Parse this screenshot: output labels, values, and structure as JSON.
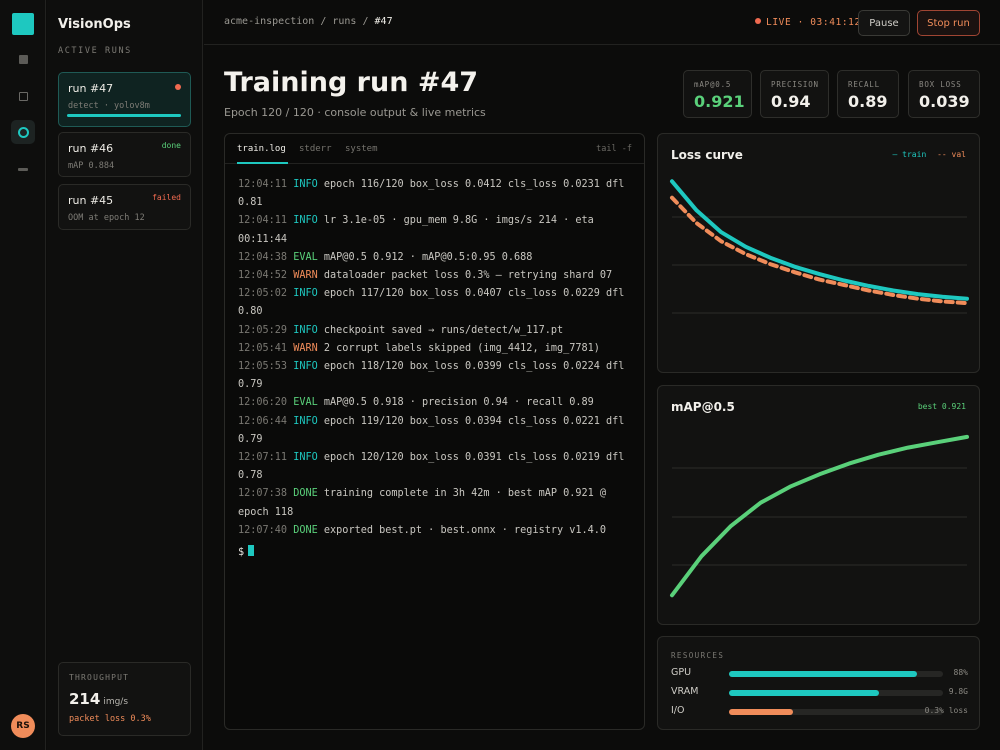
{
  "app": {
    "name": "VisionOps"
  },
  "colors": {
    "accent": "#1ec8c0",
    "good": "#5ad07a",
    "warn": "#f08c5a",
    "danger": "#f06a50"
  },
  "rail": {
    "icons": [
      "logo-icon",
      "dashboard-icon",
      "datasets-icon",
      "runs-icon",
      "settings-icon"
    ],
    "avatar": "RS"
  },
  "sidebar": {
    "section_label": "ACTIVE RUNS",
    "runs": [
      {
        "name": "run #47",
        "sub": "detect · yolov8m",
        "status": "",
        "progress": 1.0
      },
      {
        "name": "run #46",
        "sub": "mAP 0.884",
        "status": "done"
      },
      {
        "name": "run #45",
        "sub": "OOM at epoch 12",
        "status": "failed"
      }
    ],
    "throughput": {
      "label": "THROUGHPUT",
      "value": "214",
      "unit": "img/s",
      "warning": "packet loss 0.3%"
    }
  },
  "topbar": {
    "breadcrumb": [
      "acme-inspection",
      "runs",
      "#47"
    ],
    "live_label": "LIVE · 03:41:12",
    "pause_label": "Pause",
    "stop_label": "Stop run"
  },
  "header": {
    "title": "Training run #47",
    "subtitle": "Epoch 120 / 120 · console output & live metrics"
  },
  "kpis": [
    {
      "label": "mAP@0.5",
      "value": "0.921"
    },
    {
      "label": "PRECISION",
      "value": "0.94"
    },
    {
      "label": "RECALL",
      "value": "0.89"
    },
    {
      "label": "BOX LOSS",
      "value": "0.039"
    }
  ],
  "console": {
    "tabs": [
      "train.log",
      "stderr",
      "system"
    ],
    "tail_label": "tail -f",
    "lines": [
      {
        "ts": "12:04:11",
        "level": "INFO",
        "msg": "epoch 116/120 box_loss 0.0412 cls_loss 0.0231 dfl 0.81"
      },
      {
        "ts": "12:04:11",
        "level": "INFO",
        "msg": "lr 3.1e-05 · gpu_mem 9.8G · imgs/s 214 · eta 00:11:44"
      },
      {
        "ts": "12:04:38",
        "level": "EVAL",
        "msg": "mAP@0.5 0.912 · mAP@0.5:0.95 0.688"
      },
      {
        "ts": "12:04:52",
        "level": "WARN",
        "msg": "dataloader packet loss 0.3% — retrying shard 07"
      },
      {
        "ts": "12:05:02",
        "level": "INFO",
        "msg": "epoch 117/120 box_loss 0.0407 cls_loss 0.0229 dfl 0.80"
      },
      {
        "ts": "12:05:29",
        "level": "INFO",
        "msg": "checkpoint saved → runs/detect/w_117.pt"
      },
      {
        "ts": "12:05:41",
        "level": "WARN",
        "msg": "2 corrupt labels skipped (img_4412, img_7781)"
      },
      {
        "ts": "12:05:53",
        "level": "INFO",
        "msg": "epoch 118/120 box_loss 0.0399 cls_loss 0.0224 dfl 0.79"
      },
      {
        "ts": "12:06:20",
        "level": "EVAL",
        "msg": "mAP@0.5 0.918 · precision 0.94 · recall 0.89"
      },
      {
        "ts": "12:06:44",
        "level": "INFO",
        "msg": "epoch 119/120 box_loss 0.0394 cls_loss 0.0221 dfl 0.79"
      },
      {
        "ts": "12:07:11",
        "level": "INFO",
        "msg": "epoch 120/120 box_loss 0.0391 cls_loss 0.0219 dfl 0.78"
      },
      {
        "ts": "12:07:38",
        "level": "DONE",
        "msg": "training complete in 3h 42m · best mAP 0.921 @ epoch 118"
      },
      {
        "ts": "12:07:40",
        "level": "DONE",
        "msg": "exported best.pt · best.onnx · registry v1.4.0"
      }
    ],
    "prompt": "$"
  },
  "chart_data": [
    {
      "type": "line",
      "title": "Loss curve",
      "legend": "top-right",
      "grid": true,
      "ylim": [
        0,
        1
      ],
      "x": [
        0,
        1,
        2,
        3,
        4,
        5,
        6,
        7,
        8,
        9,
        10,
        11,
        12
      ],
      "series": [
        {
          "name": "train",
          "color": "#1ec8c0",
          "dashed": false,
          "values": [
            0.96,
            0.8,
            0.68,
            0.6,
            0.54,
            0.49,
            0.45,
            0.415,
            0.385,
            0.36,
            0.34,
            0.325,
            0.315
          ]
        },
        {
          "name": "val",
          "color": "#f08c5a",
          "dashed": true,
          "values": [
            0.87,
            0.73,
            0.63,
            0.56,
            0.505,
            0.46,
            0.42,
            0.39,
            0.36,
            0.335,
            0.315,
            0.3,
            0.29
          ]
        }
      ]
    },
    {
      "type": "line",
      "title": "mAP@0.5",
      "annotation": "best 0.921",
      "grid": true,
      "ylim": [
        0,
        1
      ],
      "x": [
        0,
        1,
        2,
        3,
        4,
        5,
        6,
        7,
        8,
        9,
        10
      ],
      "series": [
        {
          "name": "",
          "color": "#5ad07a",
          "dashed": false,
          "values": [
            0.06,
            0.28,
            0.45,
            0.58,
            0.67,
            0.74,
            0.8,
            0.85,
            0.89,
            0.92,
            0.95
          ]
        }
      ]
    }
  ],
  "resources": {
    "label": "RESOURCES",
    "items": [
      {
        "name": "GPU",
        "value_label": "88%",
        "fraction": 0.88,
        "color": "#1ec8c0"
      },
      {
        "name": "VRAM",
        "value_label": "9.8G",
        "fraction": 0.7,
        "color": "#1ec8c0"
      },
      {
        "name": "I/O",
        "value_label": "0.3% loss",
        "fraction": 0.3,
        "color": "#f08c5a"
      }
    ]
  }
}
